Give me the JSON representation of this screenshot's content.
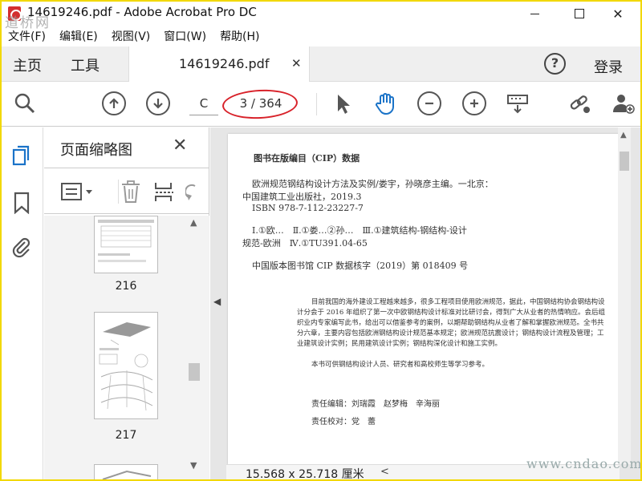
{
  "window": {
    "title": "14619246.pdf - Adobe Acrobat Pro DC",
    "watermark_top": "道桥网"
  },
  "menu": [
    "文件(F)",
    "编辑(E)",
    "视图(V)",
    "窗口(W)",
    "帮助(H)"
  ],
  "tabs": {
    "home": "主页",
    "tools": "工具",
    "document": "14619246.pdf",
    "help": "?",
    "login": "登录"
  },
  "toolbar": {
    "page_input": "C",
    "page_indicator": "3 / 364",
    "icons": [
      "search-icon",
      "page-up-icon",
      "page-down-icon",
      "select-arrow-icon",
      "hand-tool-icon",
      "zoom-out-icon",
      "zoom-in-icon",
      "keyboard-icon",
      "share-link-icon",
      "add-user-icon"
    ]
  },
  "thumbnails": {
    "title": "页面缩略图",
    "pages": [
      {
        "label": "216"
      },
      {
        "label": "217"
      }
    ]
  },
  "document_page": {
    "heading": "图书在版编目（CIP）数据",
    "lines": [
      "欧洲规范钢结构设计方法及实例/娄宇，孙晓彦主编。一北京：",
      "中国建筑工业出版社，2019.3",
      "ISBN 978-7-112-23227-7",
      "Ⅰ.①欧…　Ⅱ.①娄…②孙…　Ⅲ.①建筑结构-钢结构-设计",
      "规范-欧洲　Ⅳ.①TU391.04-65",
      "中国版本图书馆 CIP 数据核字（2019）第 018409 号"
    ],
    "paragraph": "目前我国的海外建设工程越来越多，很多工程项目使用欧洲规范，据此，中国钢结构协会钢结构设计分会于 2016 年组织了第一次中欧钢结构设计标准对比研讨会，得到广大从业者的热情响应。会后组织业内专家编写此书，给出可以借鉴参考的案例，以期帮助钢结构从业者了解和掌握欧洲规范。全书共分六章，主要内容包括欧洲钢结构设计规范基本规定；欧洲规范抗震设计；钢结构设计流程及管理；工业建筑设计实例；民用建筑设计实例；钢结构深化设计和施工实例。",
    "paragraph2": "本书可供钢结构设计人员、研究者和高校师生等学习参考。",
    "editors": "责任编辑：刘瑞霞　赵梦梅　辛海丽",
    "proofreader": "责任校对：党　蕾"
  },
  "status": {
    "dimensions": "15.568 x 25.718 厘米",
    "watermark_bottom": "www.cndao.com"
  },
  "colors": {
    "annotation_red": "#d8222a",
    "hand_tool_blue": "#1a73c8",
    "rail_blue": "#1a73c8",
    "window_border": "#f2d800"
  }
}
